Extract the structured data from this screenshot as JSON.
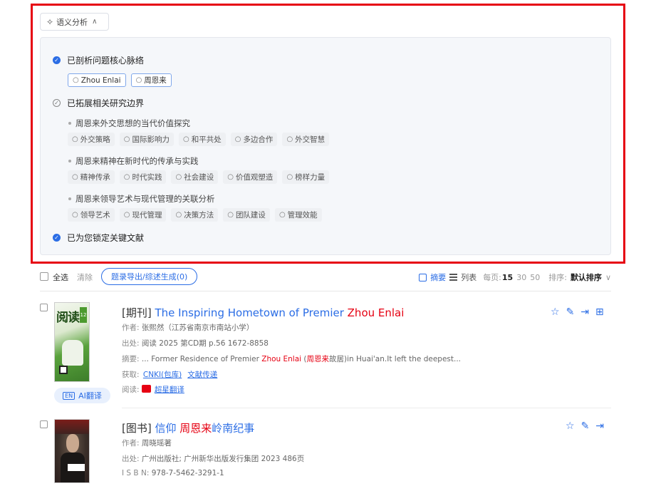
{
  "semantic": {
    "toggle_label": "语义分析",
    "steps": [
      {
        "label": "已剖析问题核心脉络",
        "status": "done"
      },
      {
        "label": "已拓展相关研究边界",
        "status": "pending"
      },
      {
        "label": "已为您锁定关键文献",
        "status": "done"
      }
    ],
    "core_keywords": [
      "Zhou Enlai",
      "周恩来"
    ],
    "topics": [
      {
        "title": "周恩来外交思想的当代价值探究",
        "keywords": [
          "外交策略",
          "国际影响力",
          "和平共处",
          "多边合作",
          "外交智慧"
        ]
      },
      {
        "title": "周恩来精神在新时代的传承与实践",
        "keywords": [
          "精神传承",
          "时代实践",
          "社会建设",
          "价值观塑造",
          "榜样力量"
        ]
      },
      {
        "title": "周恩来领导艺术与现代管理的关联分析",
        "keywords": [
          "领导艺术",
          "现代管理",
          "决策方法",
          "团队建设",
          "管理效能"
        ]
      }
    ]
  },
  "toolbar": {
    "select_all": "全选",
    "clear": "清除",
    "export_button": "题录导出/综述生成(0)",
    "view_summary": "摘要",
    "view_list": "列表",
    "per_page_label": "每页:",
    "per_page_current": "15",
    "per_page_opt2": "30",
    "per_page_opt3": "50",
    "sort_label": "排序:",
    "sort_value": "默认排序"
  },
  "records": [
    {
      "type_tag": "[期刊]",
      "title_a": "The Inspiring Hometown of Premier ",
      "title_hl": "Zhou Enlai",
      "title_b": "",
      "author_label": "作者:",
      "author": "张熙然（江苏省南京市南站小学）",
      "source_label": "出处:",
      "source": "阅读 2025 第CD期 p.56 1672-8858",
      "abstract_label": "摘要:",
      "abstract_a": "... Former Residence of Premier ",
      "abstract_hl1": "Zhou Enlai",
      "abstract_b": " (",
      "abstract_hl2": "周恩来",
      "abstract_c": "故居)in Huai'an.It left the deepest...",
      "access_label": "获取:",
      "access_1": "CNKI(包库)",
      "access_2": "文献传递",
      "read_label": "阅读:",
      "read_link": "超星翻译",
      "cover_title": "阅读",
      "cover_issue": "12",
      "ai_translate": "AI翻译",
      "ai_en": "EN"
    },
    {
      "type_tag": "[图书]",
      "title_a": "信仰 ",
      "title_hl": "周恩来",
      "title_b": "岭南纪事",
      "author_label": "作者:",
      "author": "周晓瑶著",
      "source_label": "出处:",
      "source": "广州出版社; 广州新华出版发行集团 2023 486页",
      "isbn_label": "I S B N:",
      "isbn": "978-7-5462-3291-1"
    }
  ]
}
